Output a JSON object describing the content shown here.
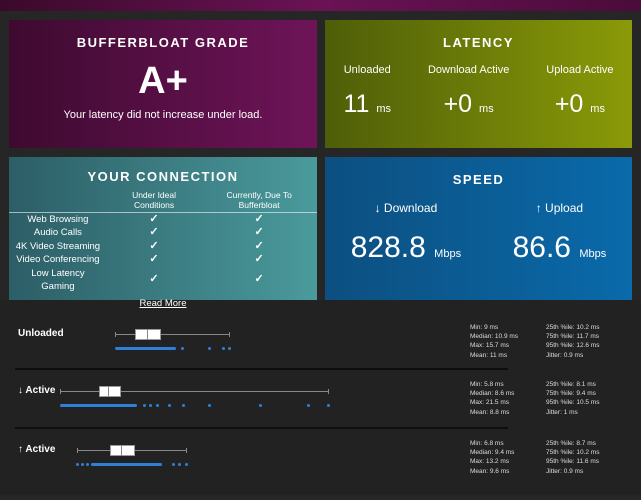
{
  "grade": {
    "title": "BUFFERBLOAT GRADE",
    "value": "A+",
    "message": "Your latency did not increase under load."
  },
  "latency": {
    "title": "LATENCY",
    "items": [
      {
        "label": "Unloaded",
        "value": "11",
        "unit": "ms"
      },
      {
        "label": "Download Active",
        "value": "+0",
        "unit": "ms"
      },
      {
        "label": "Upload Active",
        "value": "+0",
        "unit": "ms"
      }
    ]
  },
  "connection": {
    "title": "YOUR CONNECTION",
    "col1": "Under Ideal Conditions",
    "col2": "Currently, Due To Bufferbloat",
    "check": "✓",
    "rows": [
      "Web Browsing",
      "Audio Calls",
      "4K Video Streaming",
      "Video Conferencing",
      "Low Latency Gaming"
    ],
    "read_more": "Read More"
  },
  "speed": {
    "title": "SPEED",
    "download": {
      "label": "↓ Download",
      "value": "828.8",
      "unit": "Mbps"
    },
    "upload": {
      "label": "↑ Upload",
      "value": "86.6",
      "unit": "Mbps"
    }
  },
  "colors": {
    "dot": "#2f7fd6"
  },
  "rows": [
    {
      "label": "Unloaded",
      "min": 9,
      "q1": 10.2,
      "median": 10.9,
      "q3": 11.7,
      "max": 15.7,
      "dense": [
        9,
        12.6
      ],
      "outliers": [
        12.95,
        14.5,
        15.35,
        15.7
      ],
      "stats": [
        "Min: 9 ms",
        "Median: 10.9 ms",
        "Max: 15.7 ms",
        "Mean: 11 ms"
      ],
      "stats2": [
        "25th %ile: 10.2 ms",
        "75th %ile: 11.7 ms",
        "95th %ile: 12.6 ms",
        "Jitter: 0.9 ms"
      ]
    },
    {
      "label": "↓ Active",
      "min": 5.8,
      "q1": 8.1,
      "median": 8.6,
      "q3": 9.4,
      "max": 21.5,
      "dense": [
        5.8,
        10.3
      ],
      "outliers": [
        10.7,
        11.1,
        11.5,
        12.2,
        13.0,
        14.5,
        17.5,
        20.3,
        21.5
      ],
      "stats": [
        "Min: 5.8 ms",
        "Median: 8.6 ms",
        "Max: 21.5 ms",
        "Mean: 8.8 ms"
      ],
      "stats2": [
        "25th %ile: 8.1 ms",
        "75th %ile: 9.4 ms",
        "95th %ile: 10.5 ms",
        "Jitter: 1 ms"
      ]
    },
    {
      "label": "↑ Active",
      "min": 6.8,
      "q1": 8.7,
      "median": 9.4,
      "q3": 10.2,
      "max": 13.2,
      "dense": [
        7.6,
        11.8
      ],
      "outliers": [
        6.8,
        7.1,
        7.4,
        12.4,
        12.8,
        13.2
      ],
      "stats": [
        "Min: 6.8 ms",
        "Median: 9.4 ms",
        "Max: 13.2 ms",
        "Mean: 9.6 ms"
      ],
      "stats2": [
        "25th %ile: 8.7 ms",
        "75th %ile: 10.2 ms",
        "95th %ile: 11.6 ms",
        "Jitter: 0.9 ms"
      ]
    }
  ]
}
